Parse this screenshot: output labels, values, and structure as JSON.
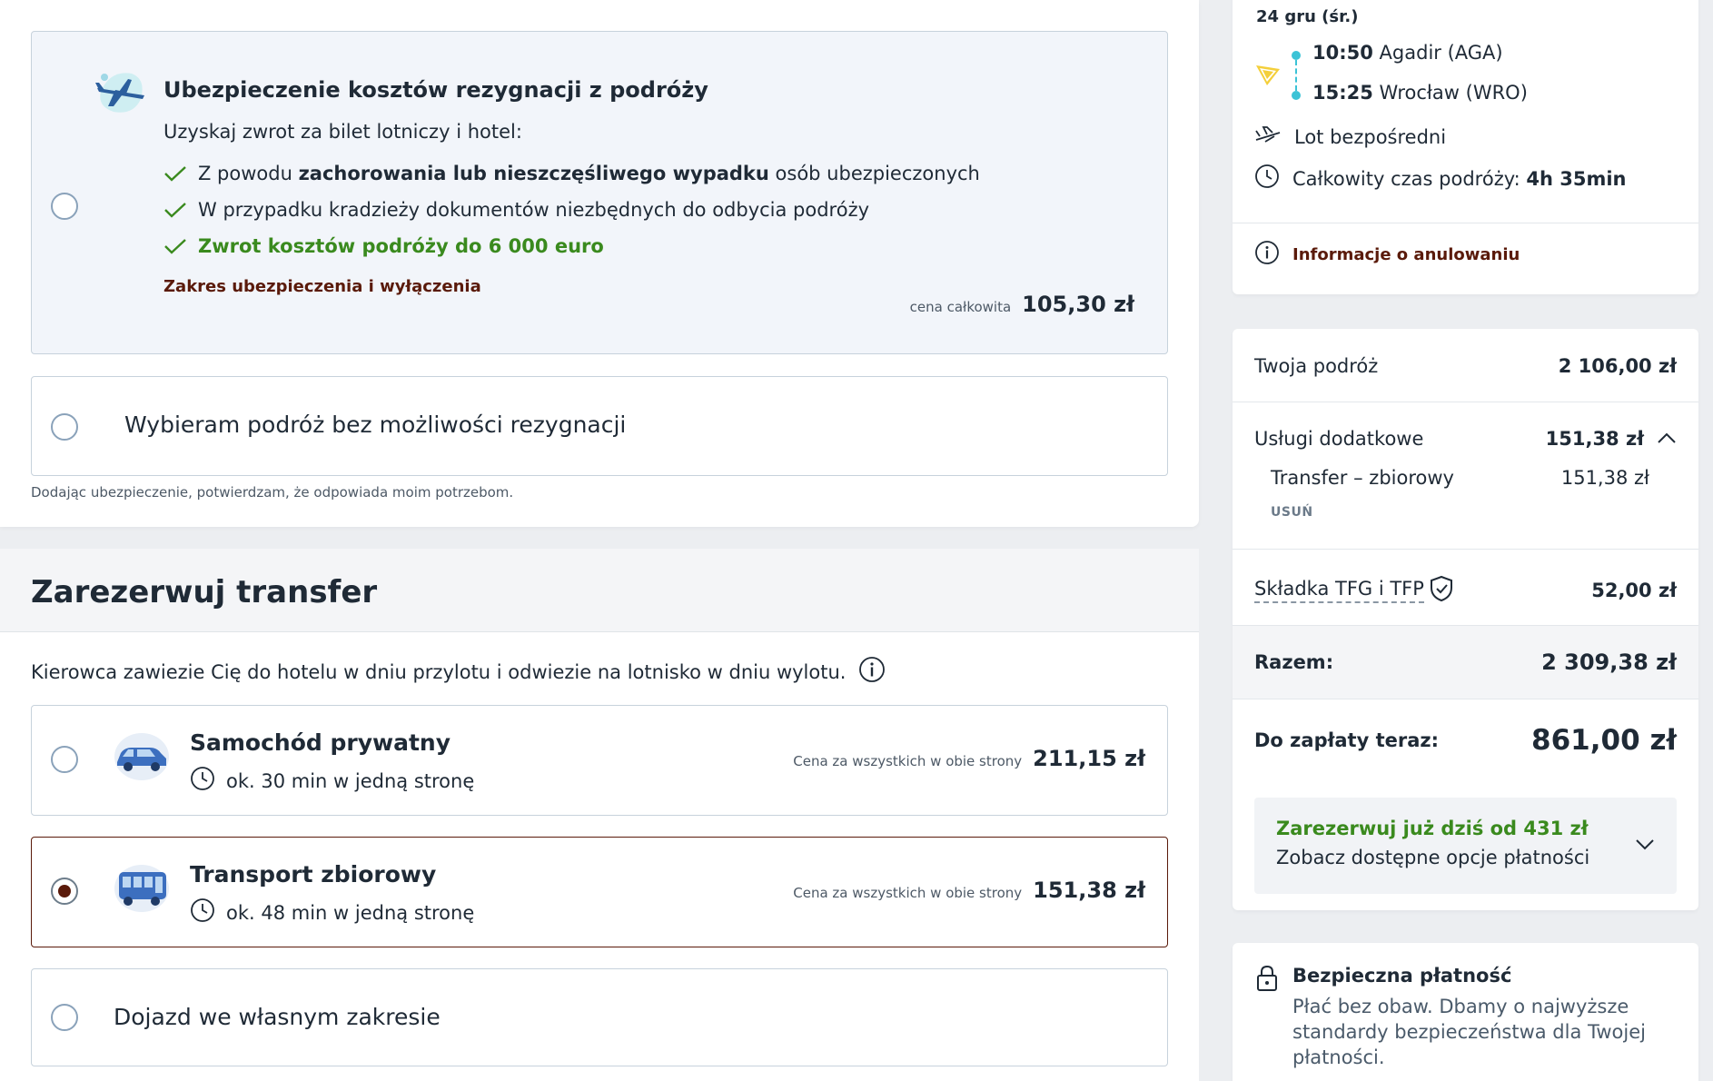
{
  "insurance": {
    "title": "Ubezpieczenie kosztów rezygnacji z podróży",
    "subtitle": "Uzyskaj zwrot za bilet lotniczy i hotel:",
    "bullet1_pre": "Z powodu ",
    "bullet1_bold": "zachorowania lub nieszczęśliwego wypadku",
    "bullet1_post": " osób ubezpieczonych",
    "bullet2": "W przypadku kradzieży dokumentów niezbędnych do odbycia podróży",
    "bullet3": "Zwrot kosztów podróży do 6 000 euro",
    "link": "Zakres ubezpieczenia i wyłączenia",
    "price_label": "cena całkowita",
    "price": "105,30 zł",
    "no_option": "Wybieram podróż bez możliwości rezygnacji",
    "disclaimer": "Dodając ubezpieczenie, potwierdzam, że odpowiada moim potrzebom."
  },
  "transfer": {
    "heading": "Zarezerwuj transfer",
    "description": "Kierowca zawiezie Cię do hotelu w dniu przylotu i odwiezie na lotnisko w dniu wylotu.",
    "options": [
      {
        "title": "Samochód prywatny",
        "duration": "ok. 30 min w jedną stronę",
        "price_label": "Cena za wszystkich w obie strony",
        "price": "211,15 zł",
        "selected": false
      },
      {
        "title": "Transport zbiorowy",
        "duration": "ok. 48 min w jedną stronę",
        "price_label": "Cena za wszystkich w obie strony",
        "price": "151,38 zł",
        "selected": true
      }
    ],
    "own_option": "Dojazd we własnym zakresie"
  },
  "flight": {
    "date": "24 gru (śr.)",
    "dep_time": "10:50",
    "dep_place": "Agadir (AGA)",
    "arr_time": "15:25",
    "arr_place": "Wrocław (WRO)",
    "direct": "Lot bezpośredni",
    "duration_label": "Całkowity czas podróży: ",
    "duration_value": "4h 35min",
    "cancel_info": "Informacje o anulowaniu"
  },
  "summary": {
    "trip_label": "Twoja podróż",
    "trip_value": "2 106,00 zł",
    "extras_label": "Usługi dodatkowe",
    "extras_value": "151,38 zł",
    "extra_item_label": "Transfer – zbiorowy",
    "extra_item_value": "151,38 zł",
    "remove": "USUŃ",
    "tfg_label": "Składka TFG i TFP",
    "tfg_value": "52,00 zł",
    "total_label": "Razem:",
    "total_value": "2 309,38 zł",
    "pay_now_label": "Do zapłaty teraz:",
    "pay_now_value": "861,00 zł",
    "promo_title": "Zarezerwuj już dziś od 431 zł",
    "promo_sub": "Zobacz dostępne opcje płatności"
  },
  "secure": {
    "title": "Bezpieczna płatność",
    "text": "Płać bez obaw. Dbamy o najwyższe standardy bezpieczeństwa dla Twojej płatności."
  },
  "colors": {
    "accent_brown": "#5a1a0a",
    "green": "#3a8a1e",
    "cyan_dots": "#3cc3d6"
  }
}
